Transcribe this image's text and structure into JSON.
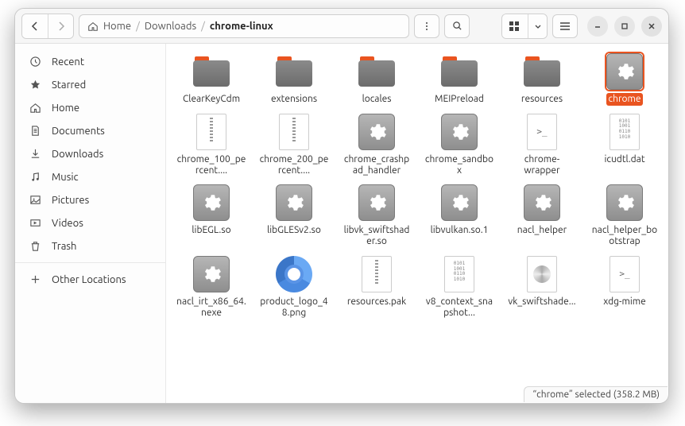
{
  "breadcrumb": {
    "home_label": "Home",
    "segments": [
      "Downloads"
    ],
    "current": "chrome-linux"
  },
  "sidebar": {
    "items": [
      {
        "icon": "clock",
        "label": "Recent"
      },
      {
        "icon": "star",
        "label": "Starred"
      },
      {
        "icon": "home",
        "label": "Home"
      },
      {
        "icon": "doc",
        "label": "Documents"
      },
      {
        "icon": "download",
        "label": "Downloads"
      },
      {
        "icon": "music",
        "label": "Music"
      },
      {
        "icon": "picture",
        "label": "Pictures"
      },
      {
        "icon": "video",
        "label": "Videos"
      },
      {
        "icon": "trash",
        "label": "Trash"
      }
    ],
    "other_locations": "Other Locations"
  },
  "files": [
    {
      "type": "folder",
      "label": "ClearKeyCdm"
    },
    {
      "type": "folder",
      "label": "extensions"
    },
    {
      "type": "folder",
      "label": "locales"
    },
    {
      "type": "folder",
      "label": "MEIPreload"
    },
    {
      "type": "folder",
      "label": "resources"
    },
    {
      "type": "exec",
      "label": "chrome",
      "selected": true
    },
    {
      "type": "archive",
      "label": "chrome_100_percent...."
    },
    {
      "type": "archive",
      "label": "chrome_200_percent...."
    },
    {
      "type": "exec",
      "label": "chrome_crashpad_handler"
    },
    {
      "type": "exec",
      "label": "chrome_sandbox"
    },
    {
      "type": "script",
      "label": "chrome-wrapper"
    },
    {
      "type": "bin",
      "label": "icudtl.dat"
    },
    {
      "type": "exec",
      "label": "libEGL.so"
    },
    {
      "type": "exec",
      "label": "libGLESv2.so"
    },
    {
      "type": "exec",
      "label": "libvk_swiftshader.so"
    },
    {
      "type": "exec",
      "label": "libvulkan.so.1"
    },
    {
      "type": "exec",
      "label": "nacl_helper"
    },
    {
      "type": "exec",
      "label": "nacl_helper_bootstrap"
    },
    {
      "type": "exec",
      "label": "nacl_irt_x86_64.nexe"
    },
    {
      "type": "chromium",
      "label": "product_logo_48.png"
    },
    {
      "type": "archive",
      "label": "resources.pak"
    },
    {
      "type": "bin",
      "label": "v8_context_snapshot..."
    },
    {
      "type": "swirl",
      "label": "vk_swiftshade..."
    },
    {
      "type": "script",
      "label": "xdg-mime"
    }
  ],
  "status": {
    "text": "“chrome” selected  (358.2 MB)"
  }
}
